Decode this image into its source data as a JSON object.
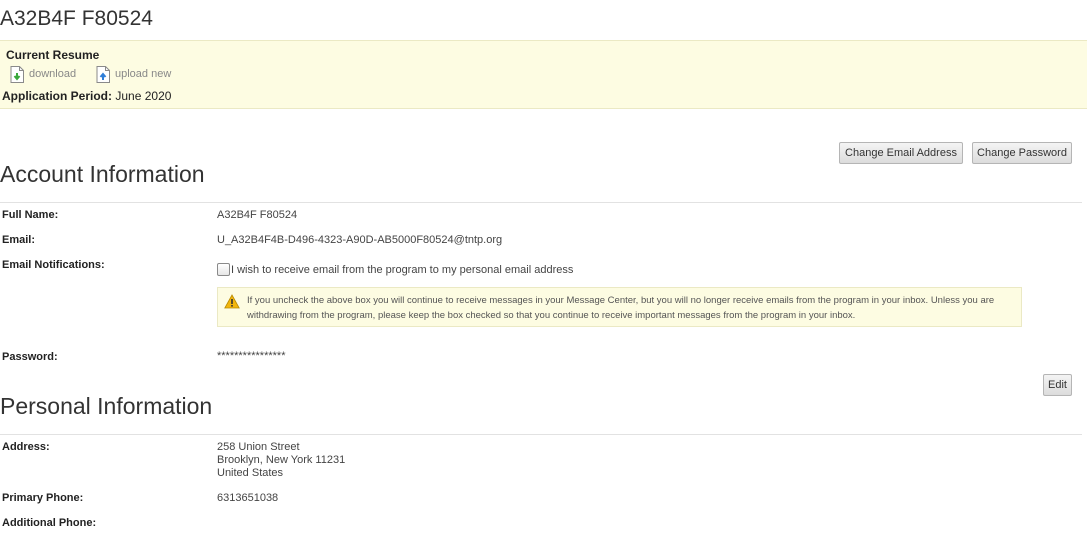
{
  "header": {
    "title": "A32B4F F80524"
  },
  "resume": {
    "title": "Current Resume",
    "download_label": "download",
    "upload_label": "upload new",
    "period_label": "Application Period:",
    "period_value": "June 2020"
  },
  "account": {
    "section_title": "Account Information",
    "change_email_label": "Change Email Address",
    "change_password_label": "Change Password",
    "full_name_label": "Full Name:",
    "full_name_value": "A32B4F F80524",
    "email_label": "Email:",
    "email_value": "U_A32B4F4B-D496-4323-A90D-AB5000F80524@tntp.org",
    "notifications_label": "Email Notifications:",
    "notifications_checkbox_text": "I wish to receive email from the program to my personal email address",
    "notifications_checked": false,
    "warning_text": "If you uncheck the above box you will continue to receive messages in your Message Center, but you will no longer receive emails from the program in your inbox. Unless you are withdrawing from the program, please keep the box checked so that you continue to receive important messages from the program in your inbox.",
    "password_label": "Password:",
    "password_value": "****************"
  },
  "personal": {
    "section_title": "Personal Information",
    "edit_label": "Edit",
    "address_label": "Address:",
    "address_lines": [
      "258 Union Street",
      "Brooklyn, New York 11231",
      "United States"
    ],
    "primary_phone_label": "Primary Phone:",
    "primary_phone_value": "6313651038",
    "additional_phone_label": "Additional Phone:"
  },
  "icons": {
    "download": "download-doc-icon",
    "upload": "upload-doc-icon",
    "warning": "warning-icon"
  },
  "colors": {
    "panel_bg": "#fdfce2",
    "download_arrow": "#3aa83a",
    "upload_arrow": "#2f7ed8",
    "warning": "#f2b60d"
  }
}
